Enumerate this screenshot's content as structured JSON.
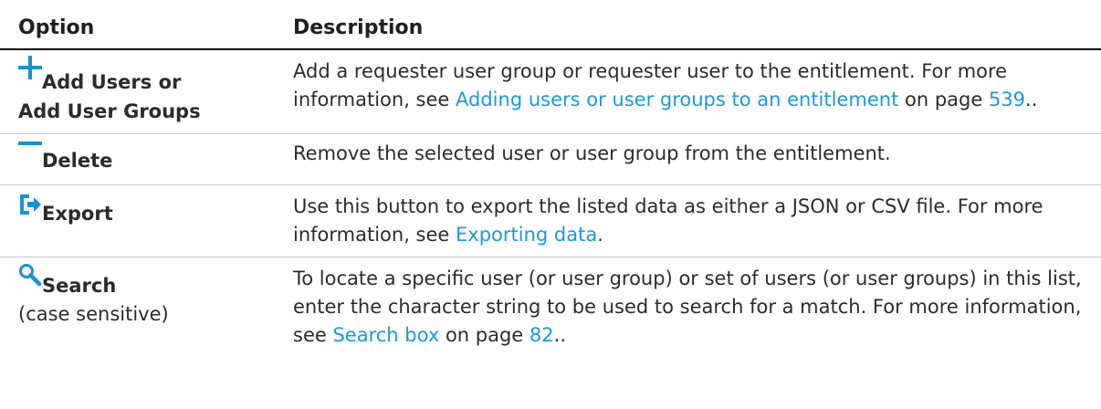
{
  "headers": {
    "option": "Option",
    "description": "Description"
  },
  "rows": [
    {
      "icon": "plus-icon",
      "option_line1": "Add Users or",
      "option_line2": "Add User Groups",
      "desc_text1": "Add a requester user group or requester user to the entitlement. For more information, see ",
      "desc_link1": "Adding users or user groups to an entitlement",
      "desc_text2": " on page ",
      "desc_link2": "539",
      "desc_text3": ".."
    },
    {
      "icon": "minus-icon",
      "option_line1": "Delete",
      "desc_text1": "Remove the selected user or user group from the entitlement."
    },
    {
      "icon": "export-icon",
      "option_line1": "Export",
      "desc_text1": "Use this button to export the listed data as either a JSON or CSV file. For more information, see ",
      "desc_link1": "Exporting data",
      "desc_text2": "."
    },
    {
      "icon": "search-icon",
      "option_line1": "Search",
      "option_sub": "(case sensitive)",
      "desc_text1": "To locate a specific user (or user group) or set of users (or user groups) in this list, enter the character string to be used to search for a match. For more information, see ",
      "desc_link1": "Search box",
      "desc_text2": " on page ",
      "desc_link2": "82",
      "desc_text3": ".."
    }
  ],
  "colors": {
    "icon": "#1593d2",
    "link": "#1a9ad6",
    "text": "#2b2b2b"
  }
}
